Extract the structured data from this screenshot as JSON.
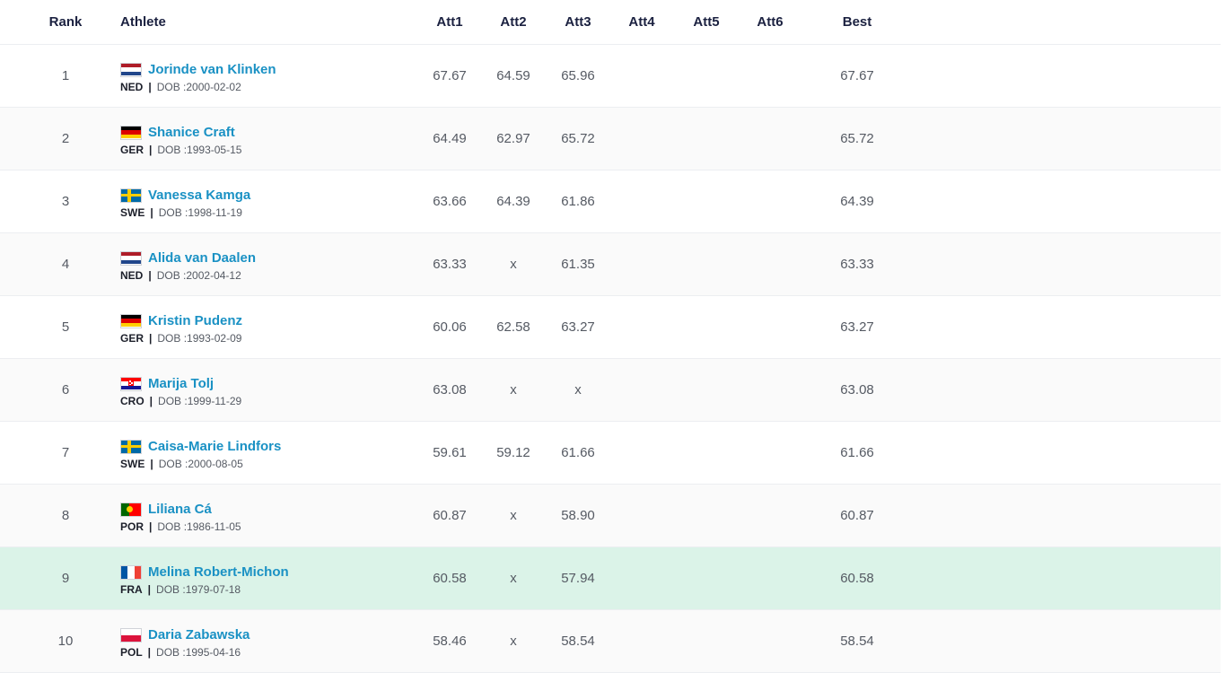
{
  "table": {
    "headers": {
      "rank": "Rank",
      "athlete": "Athlete",
      "att1": "Att1",
      "att2": "Att2",
      "att3": "Att3",
      "att4": "Att4",
      "att5": "Att5",
      "att6": "Att6",
      "best": "Best"
    },
    "dob_label": "DOB : ",
    "separator": "|",
    "rows": [
      {
        "rank": "1",
        "name": "Jorinde van Klinken",
        "country": "NED",
        "flag": "flag-ned-icon",
        "dob": "2000-02-02",
        "att1": "67.67",
        "att2": "64.59",
        "att3": "65.96",
        "att4": "",
        "att5": "",
        "att6": "",
        "best": "67.67"
      },
      {
        "rank": "2",
        "name": "Shanice Craft",
        "country": "GER",
        "flag": "flag-ger-icon",
        "dob": "1993-05-15",
        "att1": "64.49",
        "att2": "62.97",
        "att3": "65.72",
        "att4": "",
        "att5": "",
        "att6": "",
        "best": "65.72"
      },
      {
        "rank": "3",
        "name": "Vanessa Kamga",
        "country": "SWE",
        "flag": "flag-swe-icon",
        "dob": "1998-11-19",
        "att1": "63.66",
        "att2": "64.39",
        "att3": "61.86",
        "att4": "",
        "att5": "",
        "att6": "",
        "best": "64.39"
      },
      {
        "rank": "4",
        "name": "Alida van Daalen",
        "country": "NED",
        "flag": "flag-ned-icon",
        "dob": "2002-04-12",
        "att1": "63.33",
        "att2": "x",
        "att3": "61.35",
        "att4": "",
        "att5": "",
        "att6": "",
        "best": "63.33"
      },
      {
        "rank": "5",
        "name": "Kristin Pudenz",
        "country": "GER",
        "flag": "flag-ger-icon",
        "dob": "1993-02-09",
        "att1": "60.06",
        "att2": "62.58",
        "att3": "63.27",
        "att4": "",
        "att5": "",
        "att6": "",
        "best": "63.27"
      },
      {
        "rank": "6",
        "name": "Marija Tolj",
        "country": "CRO",
        "flag": "flag-cro-icon",
        "dob": "1999-11-29",
        "att1": "63.08",
        "att2": "x",
        "att3": "x",
        "att4": "",
        "att5": "",
        "att6": "",
        "best": "63.08"
      },
      {
        "rank": "7",
        "name": "Caisa-Marie Lindfors",
        "country": "SWE",
        "flag": "flag-swe-icon",
        "dob": "2000-08-05",
        "att1": "59.61",
        "att2": "59.12",
        "att3": "61.66",
        "att4": "",
        "att5": "",
        "att6": "",
        "best": "61.66"
      },
      {
        "rank": "8",
        "name": "Liliana Cá",
        "country": "POR",
        "flag": "flag-por-icon",
        "dob": "1986-11-05",
        "att1": "60.87",
        "att2": "x",
        "att3": "58.90",
        "att4": "",
        "att5": "",
        "att6": "",
        "best": "60.87"
      },
      {
        "rank": "9",
        "name": "Melina Robert-Michon",
        "country": "FRA",
        "flag": "flag-fra-icon",
        "dob": "1979-07-18",
        "att1": "60.58",
        "att2": "x",
        "att3": "57.94",
        "att4": "",
        "att5": "",
        "att6": "",
        "best": "60.58"
      },
      {
        "rank": "10",
        "name": "Daria Zabawska",
        "country": "POL",
        "flag": "flag-pol-icon",
        "dob": "1995-04-16",
        "att1": "58.46",
        "att2": "x",
        "att3": "58.54",
        "att4": "",
        "att5": "",
        "att6": "",
        "best": "58.54"
      }
    ]
  },
  "colors": {
    "athlete_link": "#1a91c4",
    "header_text": "#1b2140",
    "highlight_row": "#dbf3e8",
    "alt_row": "#fafafa"
  }
}
